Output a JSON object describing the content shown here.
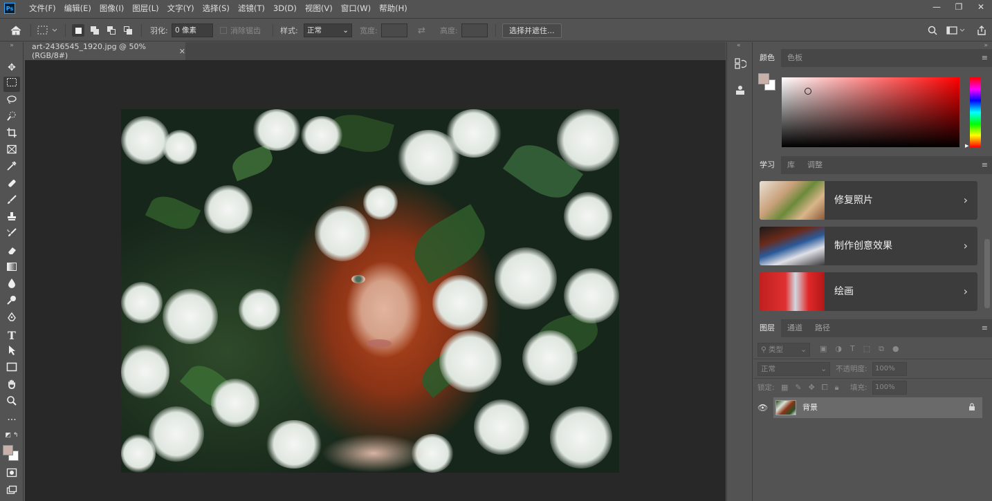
{
  "menubar": {
    "logo": "Ps",
    "items": [
      "文件(F)",
      "编辑(E)",
      "图像(I)",
      "图层(L)",
      "文字(Y)",
      "选择(S)",
      "滤镜(T)",
      "3D(D)",
      "视图(V)",
      "窗口(W)",
      "帮助(H)"
    ],
    "window_controls": [
      "—",
      "❐",
      "✕"
    ]
  },
  "options": {
    "feather_label": "羽化:",
    "feather_value": "0 像素",
    "antialias_label": "消除锯齿",
    "style_label": "样式:",
    "style_value": "正常",
    "width_label": "宽度:",
    "height_label": "高度:",
    "select_mask_button": "选择并遮住..."
  },
  "document": {
    "tab_title": "art-2436545_1920.jpg @ 50%(RGB/8#)",
    "tab_close": "✕"
  },
  "color_panel": {
    "tabs": [
      "颜色",
      "色板"
    ],
    "foreground_color": "#c9b1a9",
    "background_color": "#ffffff"
  },
  "learn_panel": {
    "tabs": [
      "学习",
      "库",
      "调整"
    ],
    "cards": [
      {
        "label": "修复照片",
        "arrow": "›"
      },
      {
        "label": "制作创意效果",
        "arrow": "›"
      },
      {
        "label": "绘画",
        "arrow": "›"
      }
    ]
  },
  "layers_panel": {
    "tabs": [
      "图层",
      "通道",
      "路径"
    ],
    "filter_placeholder": "类型",
    "blend_mode": "正常",
    "opacity_label": "不透明度:",
    "opacity_value": "100%",
    "lock_label": "锁定:",
    "fill_label": "填充:",
    "fill_value": "100%",
    "layers": [
      {
        "name": "背景",
        "visible": true,
        "locked": true
      }
    ]
  }
}
